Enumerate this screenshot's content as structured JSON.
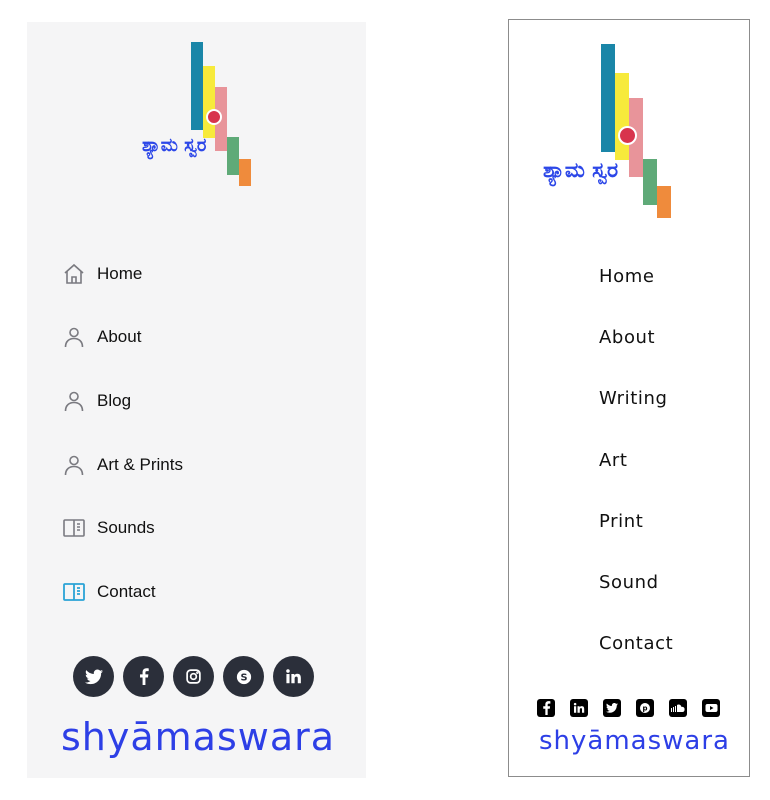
{
  "left_panel": {
    "logo_script": "ಶ್ಯಾಮ ಸ್ವರ",
    "nav": [
      {
        "label": "Home",
        "icon": "home-icon"
      },
      {
        "label": "About",
        "icon": "user-icon"
      },
      {
        "label": "Blog",
        "icon": "user-icon"
      },
      {
        "label": "Art & Prints",
        "icon": "user-icon"
      },
      {
        "label": "Sounds",
        "icon": "book-icon"
      },
      {
        "label": "Contact",
        "icon": "book-icon"
      }
    ],
    "social": [
      "twitter-icon",
      "facebook-icon",
      "instagram-icon",
      "skype-icon",
      "linkedin-icon"
    ],
    "wordmark": "shyāmaswara"
  },
  "right_panel": {
    "logo_script": "ಶ್ಯಾಮ ಸ್ವರ",
    "nav": [
      {
        "label": "Home"
      },
      {
        "label": "About"
      },
      {
        "label": "Writing"
      },
      {
        "label": "Art"
      },
      {
        "label": "Print"
      },
      {
        "label": "Sound"
      },
      {
        "label": "Contact"
      }
    ],
    "social": [
      "facebook-icon",
      "linkedin-icon",
      "twitter-icon",
      "pinterest-icon",
      "soundcloud-icon",
      "youtube-icon"
    ],
    "wordmark": "shyāmaswara"
  },
  "colors": {
    "logo_teal": "#1a86a8",
    "logo_yellow": "#f7ea3b",
    "logo_pink": "#e8949a",
    "logo_red_dot": "#d8344d",
    "logo_green": "#5faa78",
    "logo_orange": "#ef8b3c",
    "brand_blue": "#2d3fe6",
    "contact_icon_blue": "#2aa3d6"
  }
}
